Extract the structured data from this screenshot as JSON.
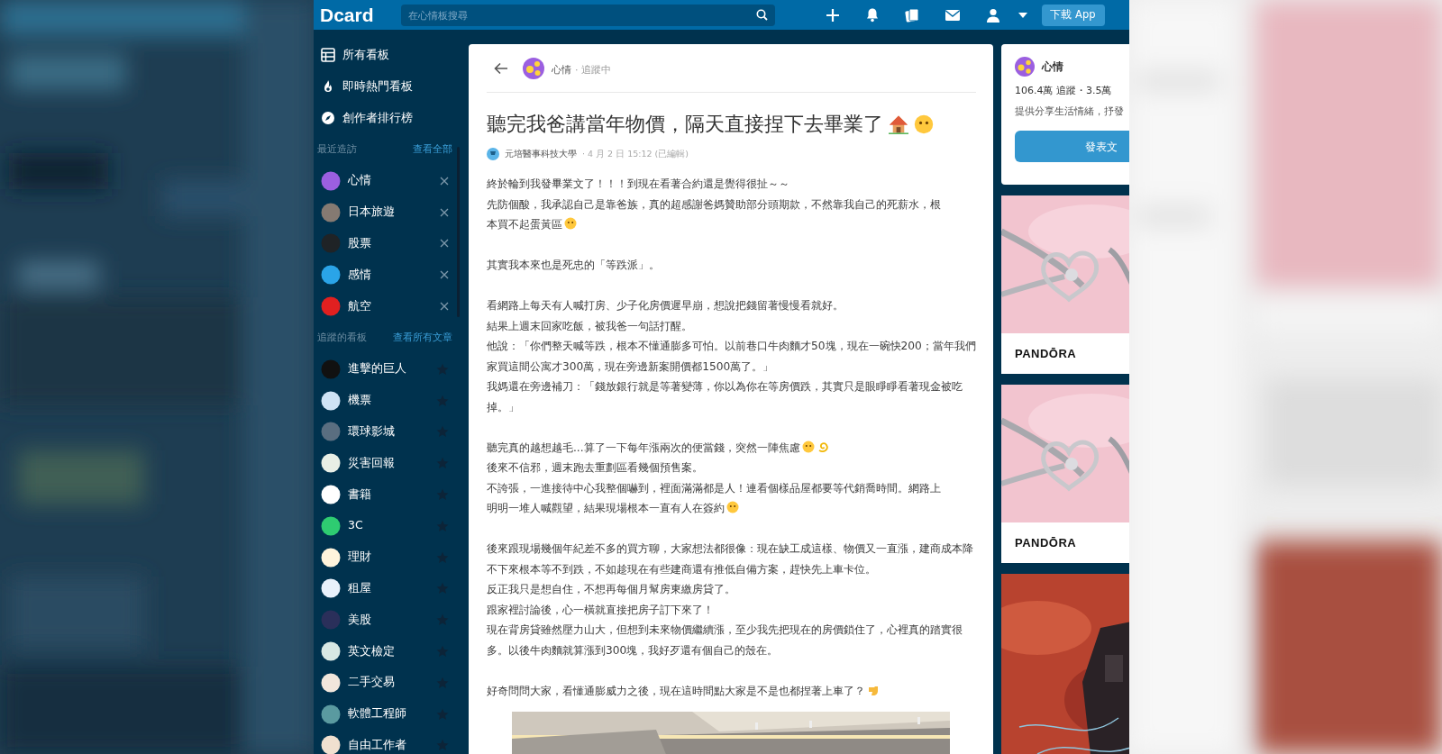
{
  "header": {
    "logo": "Dcard",
    "search": {
      "placeholder": "在心情板搜尋"
    },
    "download_button": "下載 App"
  },
  "sidebar": {
    "nav": [
      {
        "label": "所有看板",
        "kind": "list"
      },
      {
        "label": "即時熱門看板",
        "kind": "fire"
      },
      {
        "label": "創作者排行榜",
        "kind": "compass"
      }
    ],
    "recent": {
      "heading": "最近造訪",
      "link": "查看全部",
      "items": [
        {
          "name": "心情",
          "color": "#9b5fe0"
        },
        {
          "name": "日本旅遊",
          "color": "#857a72"
        },
        {
          "name": "股票",
          "color": "#1f2326"
        },
        {
          "name": "感情",
          "color": "#2aa4e8"
        },
        {
          "name": "航空",
          "color": "#e02020"
        }
      ]
    },
    "following": {
      "heading": "追蹤的看板",
      "link": "查看所有文章",
      "items": [
        {
          "name": "進擊的巨人",
          "color": "#111111"
        },
        {
          "name": "機票",
          "color": "#cfe3f5"
        },
        {
          "name": "環球影城",
          "color": "#5a6e80"
        },
        {
          "name": "災害回報",
          "color": "#e8efe6"
        },
        {
          "name": "書籍",
          "color": "#ffffff"
        },
        {
          "name": "3C",
          "color": "#2ecc71"
        },
        {
          "name": "理財",
          "color": "#fff4dc"
        },
        {
          "name": "租屋",
          "color": "#e9f1fb"
        },
        {
          "name": "美股",
          "color": "#2a2f5a"
        },
        {
          "name": "英文檢定",
          "color": "#d8e8e4"
        },
        {
          "name": "二手交易",
          "color": "#f1e6dc"
        },
        {
          "name": "軟體工程師",
          "color": "#5a9aa0"
        },
        {
          "name": "自由工作者",
          "color": "#f0e0d0"
        }
      ]
    }
  },
  "post": {
    "board": {
      "name": "心情",
      "status": "· 追蹤中"
    },
    "title": {
      "text": "聽完我爸講當年物價，隔天直接捏下去畢業了",
      "kind": "house-face"
    },
    "author": "元培醫事科技大學",
    "time": "· 4 月 2 日 15:12 (已編輯)",
    "paragraphs": [
      [
        {
          "text": "終於輪到我發畢業文了！！！到現在看著合約還是覺得很扯～～"
        },
        {
          "text": "先防個酸，我承認自己是靠爸族，真的超感謝爸媽贊助部分頭期款，不然靠我自己的死薪水，根"
        },
        {
          "text": "本買不起蛋黃區",
          "kind": "face"
        }
      ],
      [
        {
          "text": "其實我本來也是死忠的「等跌派」。"
        }
      ],
      [
        {
          "text": "看網路上每天有人喊打房、少子化房價遲早崩，想說把錢留著慢慢看就好。"
        },
        {
          "text": "結果上週末回家吃飯，被我爸一句話打醒。"
        },
        {
          "text": "他說：「你們整天喊等跌，根本不懂通膨多可怕。以前巷口牛肉麵才50塊，現在一碗快200；當年我們家買這間公寓才300萬，現在旁邊新案開價都1500萬了。」"
        },
        {
          "text": "我媽還在旁邊補刀：「錢放銀行就是等著變薄，你以為你在等房價跌，其實只是眼睜睜看著現金被吃掉。」"
        }
      ],
      [
        {
          "text": "聽完真的越想越毛...算了一下每年漲兩次的便當錢，突然一陣焦慮",
          "kind": "face-swirl"
        },
        {
          "text": "後來不信邪，週末跑去重劃區看幾個預售案。"
        },
        {
          "text": "不誇張，一進接待中心我整個嚇到，裡面滿滿都是人！連看個樣品屋都要等代銷喬時間。網路上"
        },
        {
          "text": "明明一堆人喊觀望，結果現場根本一直有人在簽約",
          "kind": "face"
        }
      ],
      [
        {
          "text": "後來跟現場幾個年紀差不多的買方聊，大家想法都很像：現在缺工成這樣、物價又一直漲，建商成本降不下來根本等不到跌，不如趁現在有些建商還有推低自備方案，趕快先上車卡位。"
        },
        {
          "text": "反正我只是想自住，不想再每個月幫房東繳房貸了。"
        },
        {
          "text": "跟家裡討論後，心一橫就直接把房子訂下來了！"
        },
        {
          "text": "現在背房貸雖然壓力山大，但想到未來物價繼續漲，至少我先把現在的房價鎖住了，心裡真的踏實很多。以後牛肉麵就算漲到300塊，我好歹還有個自己的殼在。"
        }
      ],
      [
        {
          "text": "好奇問問大家，看懂通膨威力之後，現在這時間點大家是不是也都捏著上車了？",
          "kind": "hand"
        }
      ]
    ],
    "image": {
      "kind": "picture"
    }
  },
  "board_card": {
    "name": "心情",
    "stats": "106.4萬 追蹤・3.5萬",
    "description": "提供分享生活情緒，抒發",
    "button": "發表文"
  },
  "ads": [
    {
      "kind": "jewelry",
      "brand": "PANDŌRA"
    },
    {
      "kind": "jewelry",
      "brand": "PANDŌRA"
    },
    {
      "kind": "game"
    }
  ]
}
